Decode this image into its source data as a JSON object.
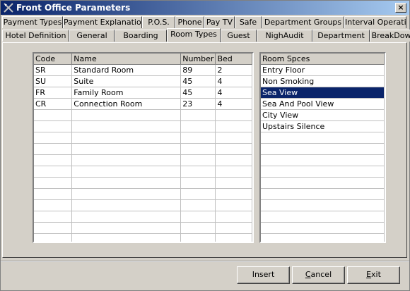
{
  "window": {
    "title": "Front Office Parameters",
    "close_label": "×"
  },
  "tabs_back": [
    "Payment Types",
    "Payment Explanations",
    "P.O.S.",
    "Phone",
    "Pay TV",
    "Safe",
    "Department Groups",
    "Interval Operation"
  ],
  "tabs_front": [
    "Hotel Definition",
    "General",
    "Boarding",
    "Room Types",
    "Guest",
    "NighAudit",
    "Department",
    "BreakDown"
  ],
  "active_tab": "Room Types",
  "room_types": {
    "columns": [
      "Code",
      "Name",
      "Number",
      "Bed"
    ],
    "rows": [
      [
        "SR",
        "Standard Room",
        "89",
        "2"
      ],
      [
        "SU",
        "Suite",
        "45",
        "4"
      ],
      [
        "FR",
        "Family Room",
        "45",
        "4"
      ],
      [
        "CR",
        "Connection Room",
        "23",
        "4"
      ]
    ]
  },
  "room_spaces": {
    "column": "Room Spces",
    "items": [
      "Entry Floor",
      "Non Smoking",
      "Sea View",
      "Sea And Pool View",
      "City View",
      "Upstairs Silence"
    ],
    "selected_index": 2
  },
  "buttons": {
    "insert": "Insert",
    "cancel": "Cancel",
    "exit": "Exit"
  },
  "colors": {
    "title_bar": "#0a246a",
    "selection": "#0a246a",
    "face": "#d4d0c8"
  }
}
